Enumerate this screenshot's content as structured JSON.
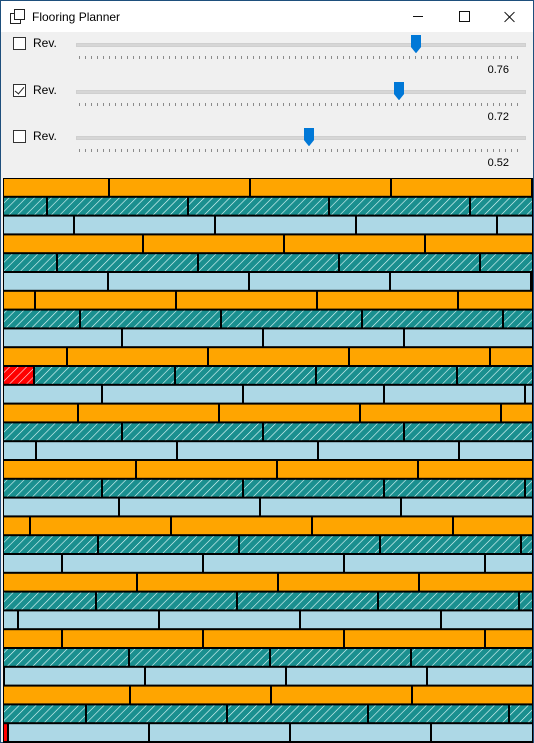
{
  "window": {
    "title": "Flooring Planner"
  },
  "controls": [
    {
      "label": "Rev.",
      "checked": false,
      "value": 0.76,
      "value_text": "0.76"
    },
    {
      "label": "Rev.",
      "checked": true,
      "value": 0.72,
      "value_text": "0.72"
    },
    {
      "label": "Rev.",
      "checked": false,
      "value": 0.52,
      "value_text": "0.52"
    }
  ],
  "colors": {
    "orange": "#ffa500",
    "teal": "#1a8f8f",
    "light": "#add8e6",
    "red": "#ff0000",
    "accent": "#0078d7"
  }
}
